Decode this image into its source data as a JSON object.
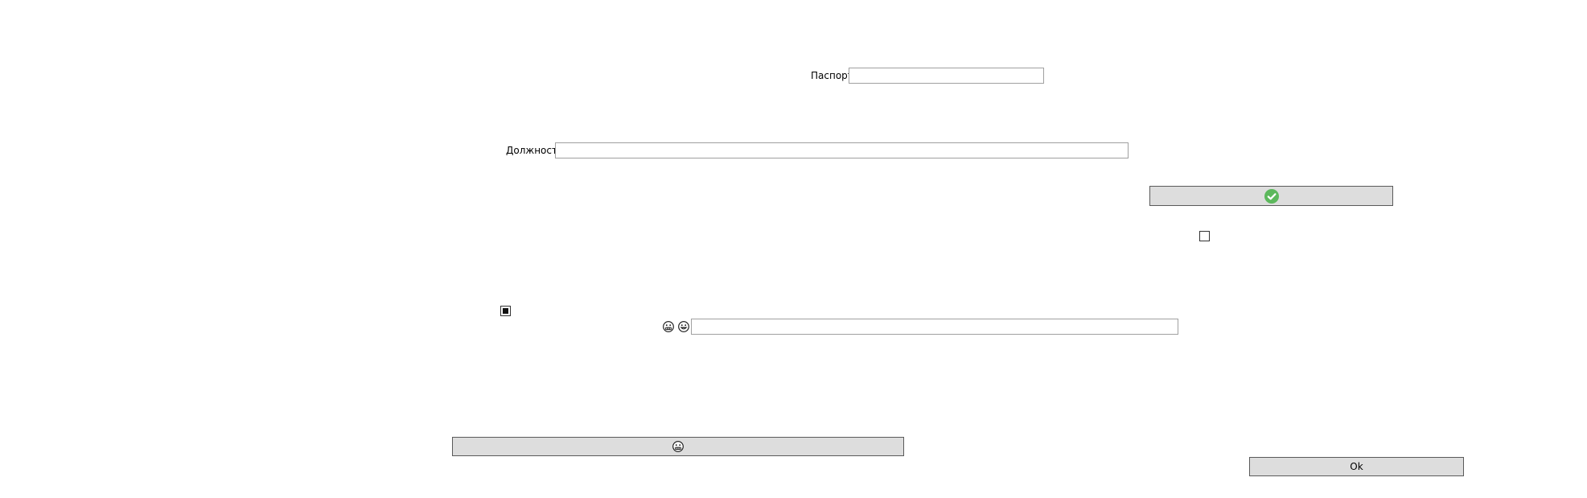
{
  "form": {
    "passport_label": "Паспорт",
    "passport_value": "",
    "position_label": "Должность",
    "position_value": "",
    "bottom_field_value": "",
    "ok_label": "Ok"
  },
  "checkboxes": {
    "top_checked": false,
    "bottom_checked": true
  },
  "icons": {
    "confirm_button_icon": "check-circle-icon",
    "confirm_icon_color": "#5cb85c",
    "field_icon_1": "grimace-face-icon",
    "field_icon_2": "grin-face-icon",
    "wide_button_icon": "grimace-face-icon"
  }
}
